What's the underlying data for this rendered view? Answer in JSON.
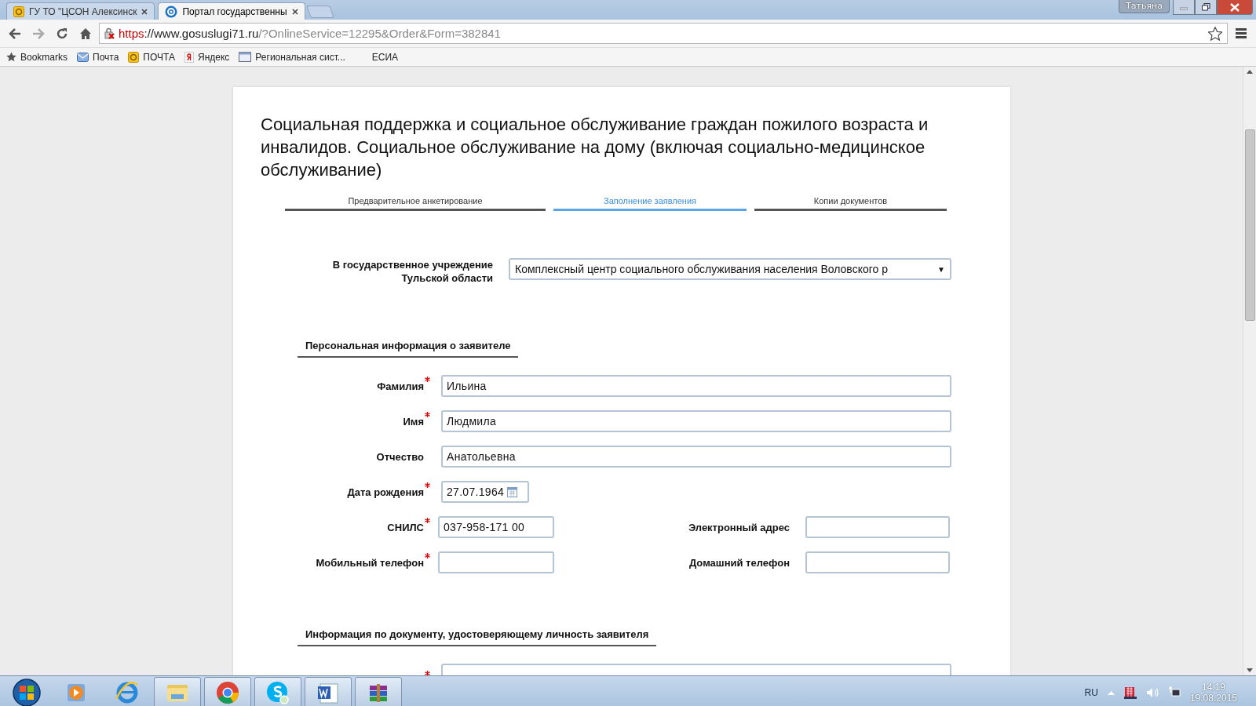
{
  "browser": {
    "tabs": [
      {
        "title": "ГУ ТО \"ЦСОН Алексинск",
        "kind": "mail",
        "selected": false
      },
      {
        "title": "Портал государственны",
        "kind": "portal",
        "selected": true
      }
    ],
    "user": "Татьяна",
    "url": {
      "scheme": "https",
      "host": "://www.gosuslugi71.ru",
      "path": "/?OnlineService=12295&Order&Form=382841",
      "insecure": true
    },
    "bookmarks": [
      {
        "label": "Bookmarks",
        "kind": "star"
      },
      {
        "label": "Почта",
        "kind": "envelope"
      },
      {
        "label": "ПОЧТА",
        "kind": "mail"
      },
      {
        "label": "Яндекс",
        "kind": "ya"
      },
      {
        "label": "Региональная сист...",
        "kind": "window"
      },
      {
        "label": "ЕСИА",
        "kind": "none"
      }
    ]
  },
  "page": {
    "title": "Социальная поддержка и социальное обслуживание граждан пожилого возраста и инвалидов. Социальное обслуживание на дому (включая социально-медицинское обслуживание)",
    "steps": [
      {
        "label": "Предварительное анкетирование",
        "selected": false
      },
      {
        "label": "Заполнение заявления",
        "selected": true
      },
      {
        "label": "Копии документов",
        "selected": false
      }
    ],
    "institution": {
      "label_lines": [
        "В государственное учреждение",
        "Тульской области"
      ],
      "value": "Комплексный центр социального обслуживания населения Воловского р",
      "caret": "▼"
    },
    "sections": [
      {
        "heading": "Персональная информация о заявителе",
        "rows": [
          {
            "kind": "full",
            "label": "Фамилия",
            "required": true,
            "value": "Ильина"
          },
          {
            "kind": "full",
            "label": "Имя",
            "required": true,
            "value": "Людмила"
          },
          {
            "kind": "full",
            "label": "Отчество",
            "required": false,
            "value": "Анатольевна"
          },
          {
            "kind": "date",
            "label": "Дата рождения",
            "required": true,
            "value": "27.07.1964"
          },
          {
            "kind": "pair",
            "label": "СНИЛС",
            "required": true,
            "value": "037-958-171 00",
            "label_2": "Электронный адрес"
          },
          {
            "kind": "pair",
            "label": "Мобильный телефон",
            "required": true,
            "label_2": "Домашний телефон"
          }
        ]
      },
      {
        "heading": "Информация по документу, удостоверяющему личность заявителя",
        "rows": [
          {
            "kind": "full",
            "required": true
          }
        ]
      }
    ]
  },
  "taskbar": {
    "apps": [
      {
        "kind": "start",
        "pinned_button": false
      },
      {
        "kind": "media",
        "pinned_button": false
      },
      {
        "kind": "ie",
        "pinned_button": false
      },
      {
        "kind": "folder",
        "pinned_button": true
      },
      {
        "kind": "chrome",
        "pinned_button": true
      },
      {
        "kind": "skype",
        "pinned_button": true
      },
      {
        "kind": "word",
        "pinned_button": true
      },
      {
        "kind": "archive",
        "pinned_button": true
      }
    ],
    "language": "RU",
    "time": "14:19",
    "date": "19.08.2015"
  }
}
